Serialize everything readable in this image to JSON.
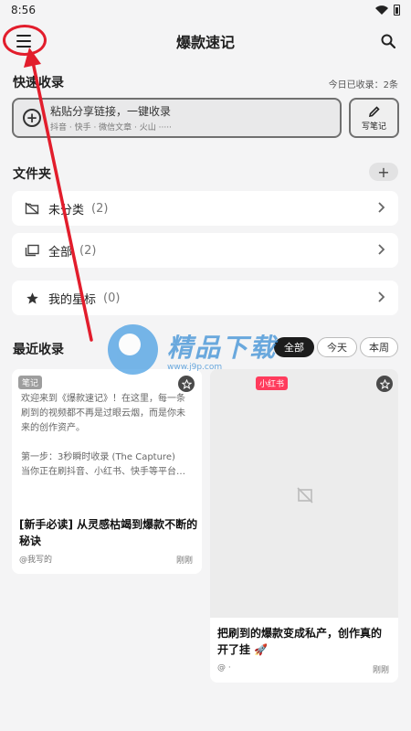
{
  "status": {
    "time": "8:56"
  },
  "appbar": {
    "title": "爆款速记"
  },
  "quick": {
    "title": "快速收录",
    "today_count": "今日已收录：2条",
    "placeholder": "粘贴分享链接，一键收录",
    "sources": "抖音 · 快手 · 微信文章 · 火山 ·····",
    "note_label": "写笔记"
  },
  "folders": {
    "title": "文件夹",
    "items": [
      {
        "label": "未分类",
        "count": "(2)",
        "icon": "folder-off-icon"
      },
      {
        "label": "全部",
        "count": "(2)",
        "icon": "folders-icon"
      },
      {
        "label": "我的星标",
        "count": "(0)",
        "icon": "star-icon"
      }
    ]
  },
  "recent": {
    "title": "最近收录",
    "filters": [
      "全部",
      "今天",
      "本周"
    ],
    "cards": [
      {
        "tag": "笔记",
        "tag_color": "#9e9e9e",
        "excerpt_lines": [
          "欢迎来到《爆款速记》！在这里，每一条",
          "刷到的视频都不再是过眼云烟，而是你未",
          "来的创作资产。",
          "",
          "第一步：3秒瞬时收录 (The Capture)",
          "当你正在刷抖音、小红书、快手等平台…"
        ],
        "title": "[新手必读] 从灵感枯竭到爆款不断的秘诀",
        "author": "@我写的",
        "time": "刚刚"
      },
      {
        "tag": "小红书",
        "tag_color": "#ff3b5c",
        "title": "把刷到的爆款变成私产，创作真的开了挂 🚀",
        "author": "@ ·",
        "time": "刚刚"
      }
    ]
  },
  "watermark": {
    "big": "精品下载",
    "small": "www.j9p.com"
  },
  "colors": {
    "highlight": "#e21d2c",
    "active_chip": "#1c1c1c"
  }
}
